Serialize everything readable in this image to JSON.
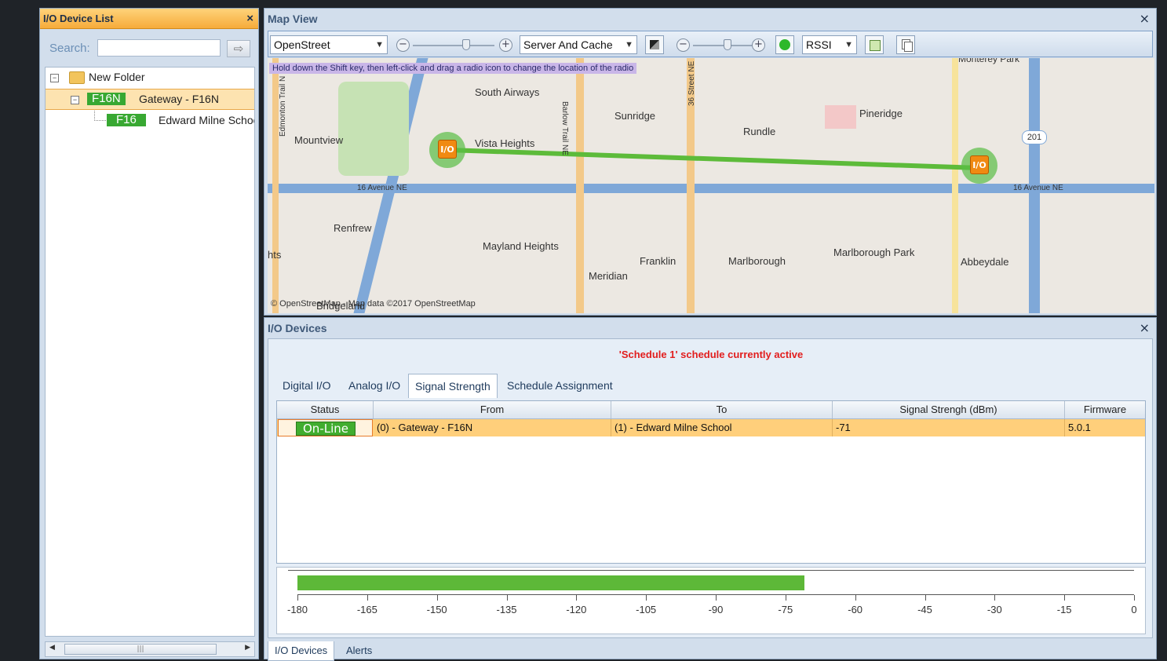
{
  "left_panel": {
    "title": "I/O Device List",
    "close": "×",
    "search_label": "Search:",
    "search_value": "",
    "search_go": "⇨",
    "tree": [
      {
        "type": "folder",
        "label": "New Folder",
        "expander": "−"
      },
      {
        "type": "gateway",
        "tag": "F16N",
        "label": "Gateway - F16N",
        "expander": "−",
        "selected": true
      },
      {
        "type": "device",
        "tag": "F16",
        "label": "Edward Milne School"
      }
    ],
    "scroll_thumb": "|||"
  },
  "map_panel": {
    "title": "Map View",
    "close": "×",
    "map_source": "OpenStreet",
    "cache_mode": "Server And Cache",
    "metric": "RSSI",
    "hint": "Hold down the Shift key, then left-click and drag a radio icon to change the location of the radio",
    "copyright": "© OpenStreetMap - Map data ©2017 OpenStreetMap",
    "place_labels": [
      "South Airways",
      "Sunridge",
      "Pineridge",
      "Rundle",
      "Mountview",
      "Vista Heights",
      "Renfrew",
      "Mayland Heights",
      "Franklin",
      "Marlborough",
      "Marlborough Park",
      "Abbeydale",
      "Meridian",
      "16 Avenue NE",
      "16 Avenue NE",
      "Barlow Trail NE",
      "36 Street NE",
      "Edmonton Trail N",
      "hts",
      "Bridgeland",
      "201",
      "Monterey Park"
    ],
    "marker_label": "I/O",
    "link_color": "#5dbb3a"
  },
  "devices_panel": {
    "title": "I/O Devices",
    "close": "×",
    "schedule_text": "'Schedule 1' schedule currently active",
    "tabs": [
      "Digital I/O",
      "Analog I/O",
      "Signal Strength",
      "Schedule Assignment"
    ],
    "active_tab": "Signal Strength",
    "columns": [
      "Status",
      "From",
      "To",
      "Signal Strengh (dBm)",
      "Firmware"
    ],
    "rows": [
      {
        "status": "On-Line",
        "from": "(0) - Gateway - F16N",
        "to": "(1) - Edward Milne School",
        "signal": "-71",
        "firmware": "5.0.1"
      }
    ],
    "meter": {
      "value": -71,
      "min": -180,
      "max": 0,
      "ticks": [
        "-180",
        "-165",
        "-150",
        "-135",
        "-120",
        "-105",
        "-90",
        "-75",
        "-60",
        "-45",
        "-30",
        "-15",
        "0"
      ]
    },
    "bottom_tabs": [
      "I/O Devices",
      "Alerts"
    ],
    "active_bottom_tab": "I/O Devices"
  }
}
